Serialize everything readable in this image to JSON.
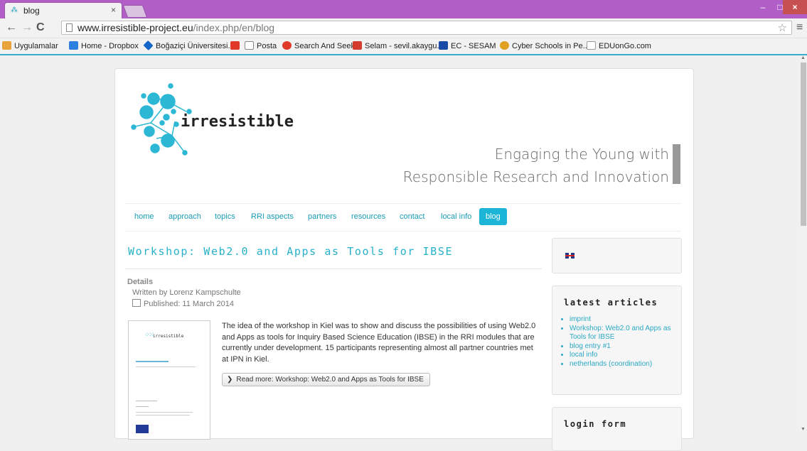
{
  "browser": {
    "tab_title": "blog",
    "tab_close": "×",
    "url_host": "www.irresistible-project.eu",
    "url_path": "/index.php/en/blog",
    "window_min": "–",
    "window_max": "□",
    "window_close": "×",
    "back": "←",
    "forward": "→",
    "reload": "C",
    "star": "☆",
    "menu": "≡"
  },
  "bookmarks": [
    {
      "label": "Uygulamalar",
      "color": "#e8a33a"
    },
    {
      "label": "Home - Dropbox",
      "color": "#2d7fe0"
    },
    {
      "label": "Boğaziçi Üniversitesi...",
      "color": "#1466c8"
    },
    {
      "label": "",
      "color": "#e0392a"
    },
    {
      "label": "Posta",
      "color": "#cccccc"
    },
    {
      "label": "Search And Seek",
      "color": "#e0392a"
    },
    {
      "label": "Selam - sevil.akaygu...",
      "color": "#d33b2c"
    },
    {
      "label": "EC - SESAM",
      "color": "#1a4aa8"
    },
    {
      "label": "Cyber Schools in Pe...",
      "color": "#e0a020"
    },
    {
      "label": "EDUonGo.com",
      "color": "#dddddd"
    }
  ],
  "site": {
    "logo_text": "irresistible",
    "tagline_1": "Engaging the Young with",
    "tagline_2": "Responsible Research and Innovation"
  },
  "nav": [
    "home",
    "approach",
    "topics",
    "RRI aspects",
    "partners",
    "resources",
    "contact",
    "local info",
    "blog"
  ],
  "article": {
    "title": "Workshop: Web2.0 and Apps as Tools for IBSE",
    "details_label": "Details",
    "author": "Written by Lorenz Kampschulte",
    "published": "Published: 11 March 2014",
    "body": "The idea of the workshop in Kiel was to show and discuss the possibilities of using Web2.0 and Apps as tools for Inquiry Based Science Education (IBSE) in the RRI modules that are currently under development. 15 participants representing almost all partner countries met at IPN in Kiel.",
    "read_more": "Read more: Workshop: Web2.0 and Apps as Tools for IBSE",
    "thumb_logo": "irresistible"
  },
  "sidebar": {
    "latest_title": "latest articles",
    "latest_items": [
      "imprint",
      "Workshop: Web2.0 and Apps as Tools for IBSE",
      "blog entry #1",
      "local info",
      "netherlands (coordination)"
    ],
    "login_title": "login form"
  }
}
